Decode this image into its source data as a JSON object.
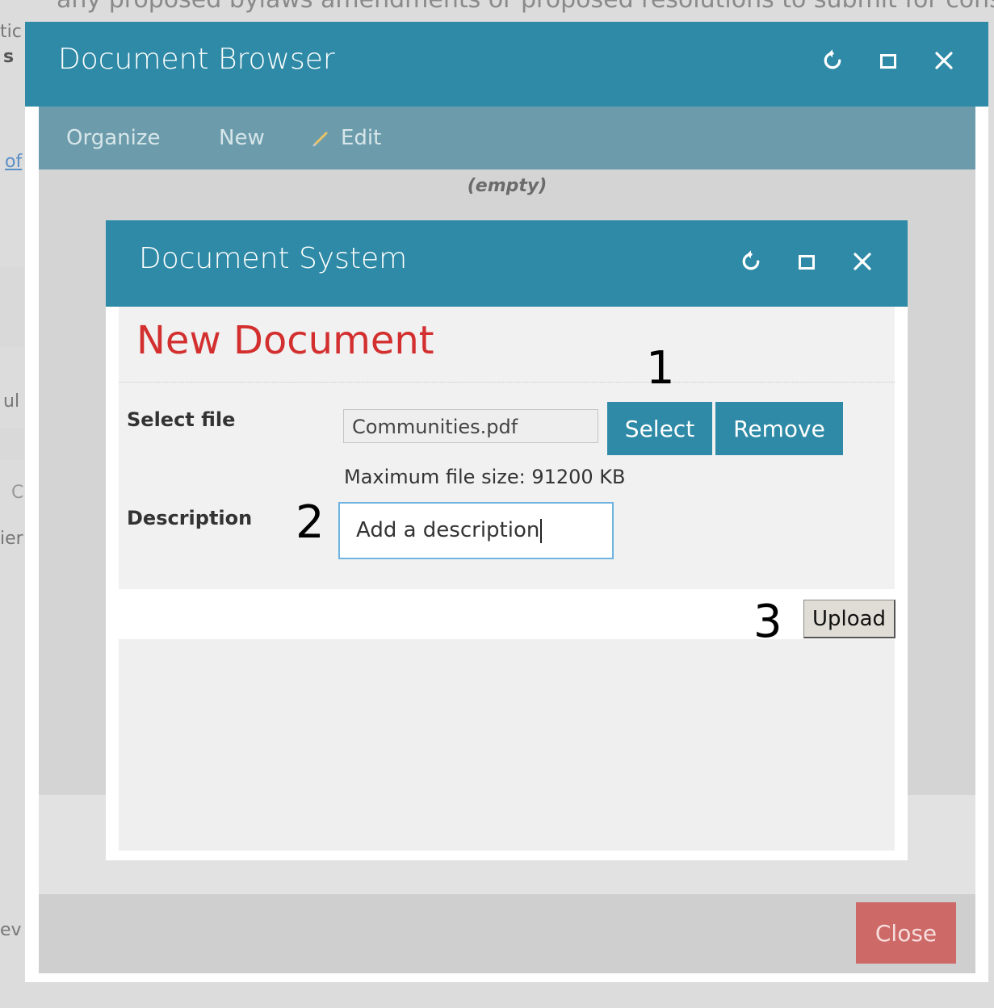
{
  "background": {
    "top_text": "any proposed bylaws amendments or proposed resolutions to submit for conside",
    "frag_1": "tic",
    "frag_2": "s",
    "frag_link": "of",
    "frag_3": "ul",
    "frag_4": "C",
    "frag_5": "ier",
    "frag_6": "ev"
  },
  "outer_dialog": {
    "title": "Document Browser",
    "refresh_icon": "refresh-icon",
    "maximize_icon": "maximize-icon",
    "close_icon": "close-icon",
    "toolbar": {
      "organize": "Organize",
      "new": "New",
      "edit": "Edit",
      "edit_icon": "pencil-icon"
    },
    "empty_label": "(empty)",
    "close_button": "Close"
  },
  "inner_dialog": {
    "title": "Document System",
    "heading": "New Document",
    "select_file_label": "Select file",
    "file_value": "Communities.pdf",
    "select_button": "Select",
    "remove_button": "Remove",
    "max_file_size": "Maximum file size: 91200 KB",
    "description_label": "Description",
    "description_value": "Add a description",
    "upload_button": "Upload"
  },
  "annotations": {
    "step1": "1",
    "step2": "2",
    "step3": "3"
  },
  "colors": {
    "titlebar": "#2e8aa6",
    "toolbar": "#6c9cab",
    "heading_red": "#d32f2f",
    "close_button": "#cd6a67"
  }
}
